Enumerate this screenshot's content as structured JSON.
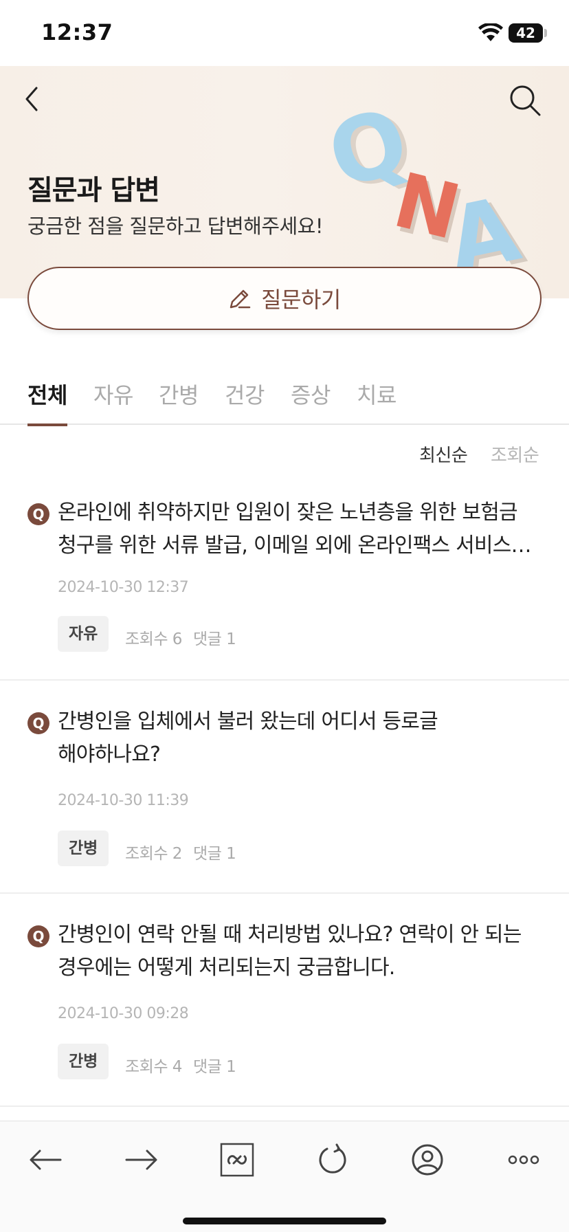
{
  "status": {
    "time": "12:37",
    "battery": "42"
  },
  "hero": {
    "title": "질문과 답변",
    "subtitle": "궁금한 점을 질문하고 답변해주세요!",
    "art_letters": [
      "Q",
      "N",
      "A"
    ]
  },
  "ask_button": {
    "label": "질문하기",
    "icon": "pencil-icon"
  },
  "tabs": [
    {
      "label": "전체",
      "active": true
    },
    {
      "label": "자유",
      "active": false
    },
    {
      "label": "간병",
      "active": false
    },
    {
      "label": "건강",
      "active": false
    },
    {
      "label": "증상",
      "active": false
    },
    {
      "label": "치료",
      "active": false
    }
  ],
  "sort": {
    "latest": "최신순",
    "views": "조회순",
    "selected": "최신순"
  },
  "posts": [
    {
      "badge": "Q",
      "title": "온라인에 취약하지만 입원이 잦은 노년층을 위한 보험금 청구를 위한 서류 발급, 이메일 외에 온라인팩스 서비스…",
      "date": "2024-10-30 12:37",
      "tag": "자유",
      "views": "조회수 6",
      "comments": "댓글 1"
    },
    {
      "badge": "Q",
      "title": "간병인을 입체에서 불러 왔는데 어디서 등로글 해야하나요?",
      "date": "2024-10-30 11:39",
      "tag": "간병",
      "views": "조회수 2",
      "comments": "댓글 1"
    },
    {
      "badge": "Q",
      "title": "간병인이 연락 안될 때 처리방법 있나요? 연락이 안 되는 경우에는 어떻게 처리되는지 궁금합니다.",
      "date": "2024-10-30 09:28",
      "tag": "간병",
      "views": "조회수 4",
      "comments": "댓글 1"
    }
  ],
  "toolbar": [
    "back-arrow-icon",
    "forward-arrow-icon",
    "link-icon",
    "refresh-icon",
    "profile-icon",
    "more-icon"
  ],
  "colors": {
    "accent": "#7a4a3c",
    "hero_bg": "#f7efe7",
    "inactive_text": "#aaaaaa"
  }
}
